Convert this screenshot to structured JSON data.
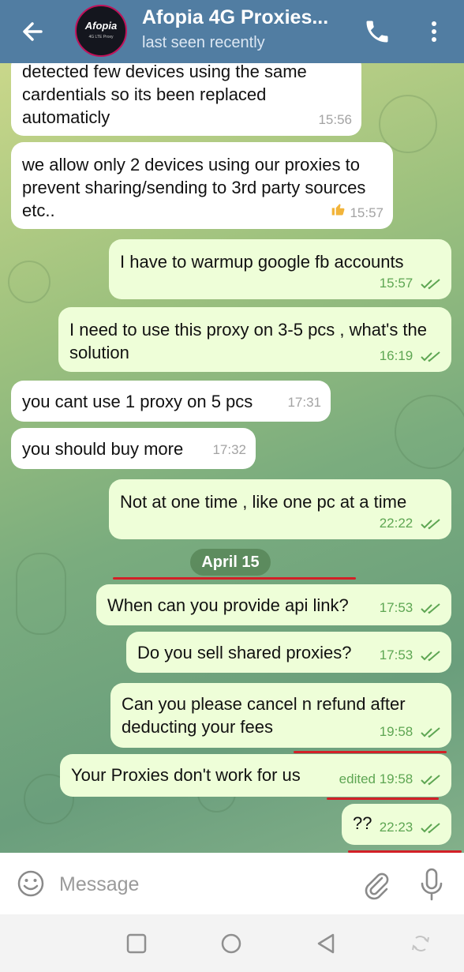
{
  "header": {
    "title": "Afopia 4G Proxies...",
    "status": "last seen recently",
    "avatar_text": "Afopia",
    "avatar_subtext": "4G LTE Proxy",
    "back_icon": "arrow-left-icon",
    "call_icon": "phone-icon",
    "menu_icon": "more-vertical-icon"
  },
  "messages": [
    {
      "text": "detected few devices using the same cardentials so its been replaced automaticly",
      "time": "15:56",
      "direction": "in"
    },
    {
      "text": "we allow only 2 devices using our proxies to prevent sharing/sending to 3rd party sources etc..",
      "time": "15:57",
      "direction": "in",
      "reaction": "thumbs-up"
    },
    {
      "text": "I have to warmup google fb accounts",
      "time": "15:57",
      "direction": "out"
    },
    {
      "text": "I need to use this proxy on  3-5 pcs , what's the solution",
      "time": "16:19",
      "direction": "out"
    },
    {
      "text": "you cant use 1 proxy on 5 pcs",
      "time": "17:31",
      "direction": "in"
    },
    {
      "text": "you should buy more",
      "time": "17:32",
      "direction": "in"
    },
    {
      "text": "Not at one time , like one pc at a time",
      "time": "22:22",
      "direction": "out"
    },
    {
      "text": "When can you provide api link?",
      "time": "17:53",
      "direction": "out"
    },
    {
      "text": "Do you sell shared proxies?",
      "time": "17:53",
      "direction": "out"
    },
    {
      "text": "Can you please cancel n refund after deducting your fees",
      "time": "19:58",
      "direction": "out"
    },
    {
      "text": "Your Proxies don't work for us",
      "time": "edited 19:58",
      "direction": "out"
    },
    {
      "text": "??",
      "time": "22:23",
      "direction": "out"
    }
  ],
  "date_separator": "April 15",
  "composer": {
    "placeholder": "Message",
    "emoji_icon": "emoji-icon",
    "attach_icon": "paperclip-icon",
    "mic_icon": "microphone-icon"
  },
  "nav": [
    "square-icon",
    "circle-icon",
    "triangle-back-icon",
    "rotate-icon"
  ],
  "colors": {
    "header": "#517da2",
    "incoming_bubble": "#ffffff",
    "outgoing_bubble": "#eefed8",
    "check_green": "#5ea653",
    "annotation_red": "#d32027"
  }
}
